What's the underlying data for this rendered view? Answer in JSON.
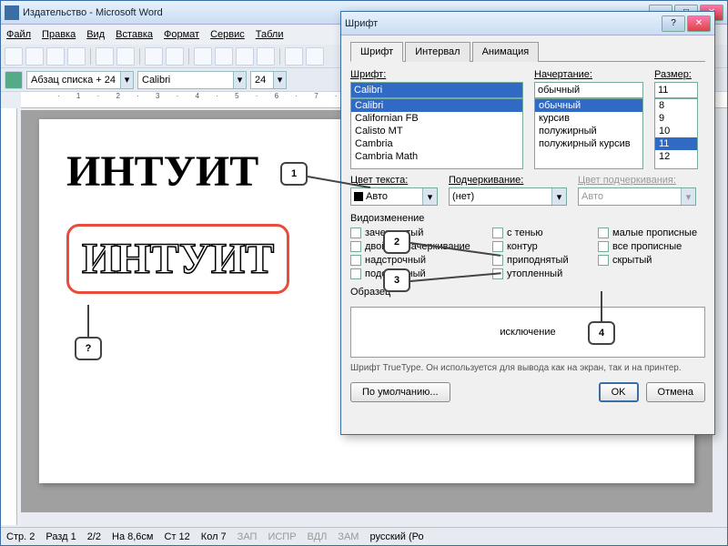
{
  "main_window": {
    "title": "Издательство - Microsoft Word"
  },
  "menu": {
    "file": "Файл",
    "edit": "Правка",
    "view": "Вид",
    "insert": "Вставка",
    "format": "Формат",
    "tools": "Сервис",
    "table": "Табли"
  },
  "stylebar": {
    "style": "Абзац списка + 24",
    "font": "Calibri",
    "size": "24"
  },
  "doc": {
    "text1": "ИНТУИТ",
    "text2": "ИНТУИТ"
  },
  "callouts": {
    "c1": "1",
    "c2": "2",
    "c3": "3",
    "c4": "4",
    "cq": "?"
  },
  "status": {
    "page": "Стр. 2",
    "sec": "Разд 1",
    "pages": "2/2",
    "at": "На 8,6см",
    "line": "Ст 12",
    "col": "Кол 7",
    "rec": "ЗАП",
    "trk": "ИСПР",
    "ext": "ВДЛ",
    "ovr": "ЗАМ",
    "lang": "русский (Ро"
  },
  "dialog": {
    "title": "Шрифт",
    "tabs": {
      "font": "Шрифт",
      "spacing": "Интервал",
      "anim": "Анимация"
    },
    "labels": {
      "font": "Шрифт:",
      "style": "Начертание:",
      "size": "Размер:",
      "color": "Цвет текста:",
      "underline": "Подчеркивание:",
      "ucolor": "Цвет подчеркивания:",
      "effects": "Видоизменение",
      "preview": "Образец"
    },
    "fontval": "Calibri",
    "styleval": "обычный",
    "sizeval": "11",
    "fontlist": [
      "Calibri",
      "Californian FB",
      "Calisto MT",
      "Cambria",
      "Cambria Math"
    ],
    "stylelist": [
      "обычный",
      "курсив",
      "полужирный",
      "полужирный курсив"
    ],
    "sizelist": [
      "8",
      "9",
      "10",
      "11",
      "12"
    ],
    "color": "Авто",
    "underline": "(нет)",
    "ucolor": "Авто",
    "effects": {
      "strike": "зачеркнутый",
      "dstrike": "двойное зачеркивание",
      "sup": "надстрочный",
      "sub": "подстрочный",
      "shadow": "с тенью",
      "outline": "контур",
      "emboss": "приподнятый",
      "engrave": "утопленный",
      "smallcaps": "малые прописные",
      "allcaps": "все прописные",
      "hidden": "скрытый"
    },
    "previewtext": "исключение",
    "hint": "Шрифт TrueType. Он используется для вывода как на экран, так и на принтер.",
    "buttons": {
      "default": "По умолчанию...",
      "ok": "OK",
      "cancel": "Отмена"
    }
  }
}
